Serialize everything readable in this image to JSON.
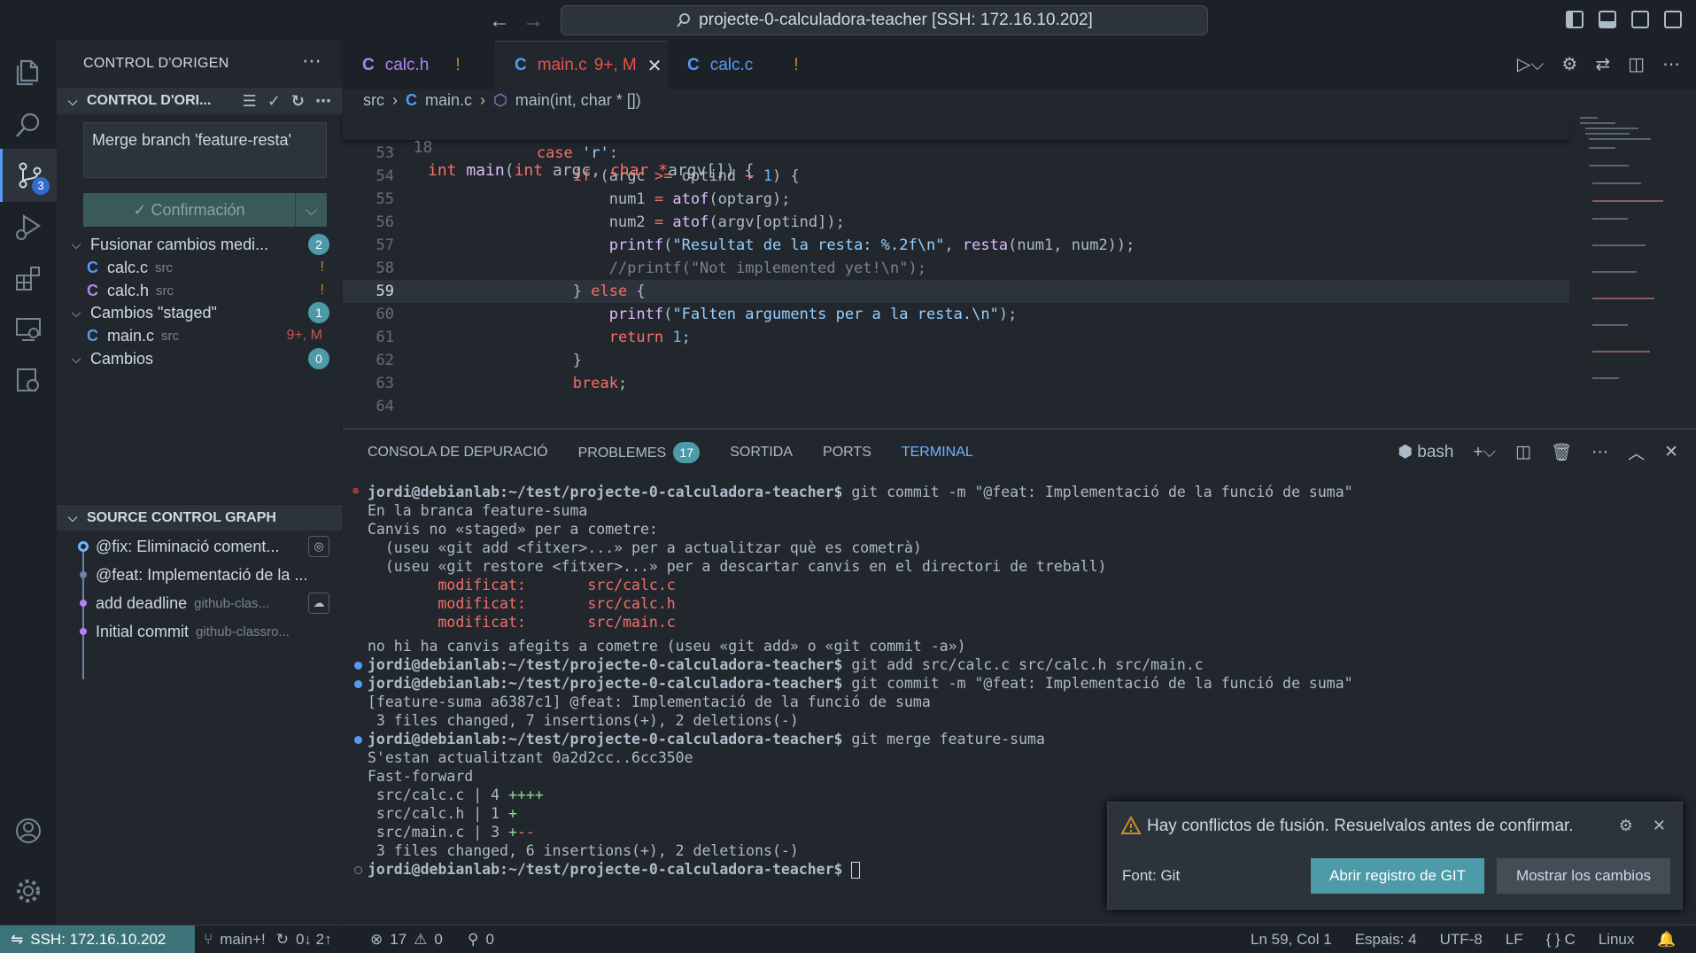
{
  "titlebar": {
    "command_center": "projecte-0-calculadora-teacher [SSH: 172.16.10.202]"
  },
  "activity": {
    "scm_badge": "3"
  },
  "sidebar": {
    "title": "CONTROL D'ORIGEN",
    "section_title": "CONTROL D'ORI...",
    "commit_message": "Merge branch 'feature-resta'",
    "commit_button": "✓ Confirmación",
    "groups": [
      {
        "label": "Fusionar cambios medi...",
        "count": "2"
      },
      {
        "label": "Cambios \"staged\"",
        "count": "1"
      },
      {
        "label": "Cambios",
        "count": "0"
      }
    ],
    "merge_files": [
      {
        "name": "calc.c",
        "dir": "src",
        "status": "!"
      },
      {
        "name": "calc.h",
        "dir": "src",
        "status": "!"
      }
    ],
    "staged_files": [
      {
        "name": "main.c",
        "dir": "src",
        "status": "9+, M"
      }
    ],
    "graph_title": "SOURCE CONTROL GRAPH",
    "graph": [
      {
        "label": "@fix: Eliminació coment...",
        "meta": ""
      },
      {
        "label": "@feat: Implementació de la ...",
        "meta": ""
      },
      {
        "label": "add deadline",
        "meta": "github-clas..."
      },
      {
        "label": "Initial commit",
        "meta": "github-classro..."
      }
    ]
  },
  "tabs": [
    {
      "icon": "C",
      "name": "calc.h",
      "status": "!"
    },
    {
      "icon": "C",
      "name": "main.c",
      "status": "9+, M"
    },
    {
      "icon": "C",
      "name": "calc.c",
      "status": "!"
    }
  ],
  "breadcrumb": {
    "folder": "src",
    "file": "main.c",
    "symbol": "main(int, char * [])"
  },
  "editor": {
    "sticky_line": "18",
    "current_line": "59"
  },
  "panel": {
    "tabs": [
      "CONSOLA DE DEPURACIÓ",
      "PROBLEMES",
      "SORTIDA",
      "PORTS",
      "TERMINAL"
    ],
    "problems_count": "17",
    "shell": "bash"
  },
  "terminal": {
    "prompt_user": "jordi@debianlab",
    "prompt_path": ":~/test/projecte-0-calculadora-teacher$",
    "cmd1": " git commit -m \"@feat: Implementació de la funció de suma\"",
    "out1": [
      "En la branca feature-suma",
      "Canvis no «staged» per a cometre:",
      "  (useu «git add <fitxer>...» per a actualitzar què es cometrà)",
      "  (useu «git restore <fitxer>...» per a descartar canvis en el directori de treball)"
    ],
    "modified": [
      {
        "label": "        modificat:",
        "file": "src/calc.c"
      },
      {
        "label": "        modificat:",
        "file": "src/calc.h"
      },
      {
        "label": "        modificat:",
        "file": "src/main.c"
      }
    ],
    "out2": "no hi ha canvis afegits a cometre (useu «git add» o «git commit -a»)",
    "cmd2": " git add src/calc.c src/calc.h src/main.c",
    "cmd3": " git commit -m \"@feat: Implementació de la funció de suma\"",
    "out3": "[feature-suma a6387c1] @feat: Implementació de la funció de suma",
    "out4": " 3 files changed, 7 insertions(+), 2 deletions(-)",
    "cmd4": " git merge feature-suma",
    "out5": "S'estan actualitzant 0a2d2cc..6cc350e",
    "out6": "Fast-forward",
    "stat1": " src/calc.c | 4 ",
    "stat1b": "++++",
    "stat2": " src/calc.h | 1 ",
    "stat2b": "+",
    "stat3": " src/main.c | 3 ",
    "stat3a": "+",
    "stat3b": "--",
    "out7": " 3 files changed, 6 insertions(+), 2 deletions(-)"
  },
  "notification": {
    "message": "Hay conflictos de fusión. Resuelvalos antes de confirmar.",
    "source": "Font: Git",
    "primary_button": "Abrir registro de GIT",
    "secondary_button": "Mostrar los cambios"
  },
  "status": {
    "remote": "SSH: 172.16.10.202",
    "branch": "main+!",
    "sync": "0↓ 2↑",
    "errors": "17",
    "warnings": "0",
    "ports": "0",
    "position": "Ln 59, Col 1",
    "spaces": "Espais: 4",
    "encoding": "UTF-8",
    "eol": "LF",
    "language": "C",
    "os": "Linux"
  },
  "colors": {
    "accent": "#4d9aa8",
    "remote_bg": "#3c7378",
    "error": "#e5534b",
    "modified": "#c69026"
  }
}
